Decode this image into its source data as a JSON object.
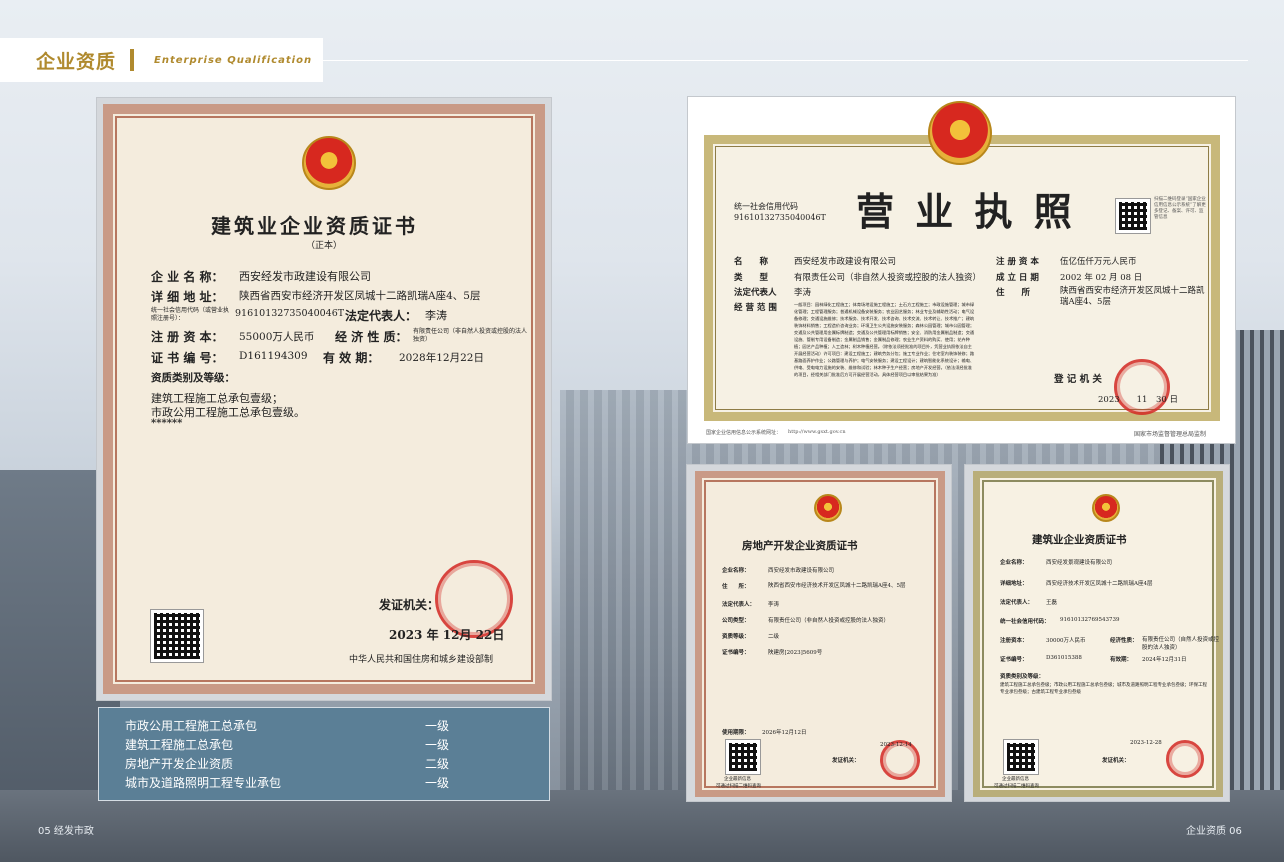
{
  "header": {
    "title": "企业资质",
    "subtitle": "Enterprise Qualification"
  },
  "main_cert": {
    "title": "建筑业企业资质证书",
    "copy_type": "（正本）",
    "company_label": "企 业 名 称：",
    "company": "西安经发市政建设有限公司",
    "address_label": "详 细 地 址：",
    "address": "陕西省西安市经济开发区凤城十二路凯瑞A座4、5层",
    "credit_label": "统一社会信用代码（或营业执照注册号）：",
    "credit_code": "91610132735040046T",
    "rep_label": "法定代表人：",
    "rep": "李涛",
    "capital_label": "注 册 资 本：",
    "capital": "55000万人民币",
    "nature_label": "经 济 性 质：",
    "nature": "有限责任公司（非自然人投资或控股的法人独资）",
    "number_label": "证 书 编 号：",
    "number": "D161194309",
    "valid_label": "有 效 期：",
    "valid": "2028年12月22日",
    "category_label": "资质类别及等级：",
    "category_1": "建筑工程施工总承包壹级；",
    "category_2": "市政公用工程施工总承包壹级。",
    "stars": "******",
    "issuer_label": "发证机关：",
    "issue_date": "2023 年 12月 22日",
    "ministry": "中华人民共和国住房和城乡建设部制"
  },
  "license": {
    "title": "营 业 执 照",
    "credit_label": "统一社会信用代码",
    "credit_code": "91610132735040046T",
    "name_label": "名　　称",
    "name": "西安经发市政建设有限公司",
    "type_label": "类　　型",
    "type": "有限责任公司（非自然人投资或控股的法人独资）",
    "rep_label": "法定代表人",
    "rep": "李涛",
    "scope_label": "经 营 范 围",
    "scope": "一般项目：园林绿化工程施工；体育场地设施工程施工；土石方工程施工；市政设施管理；城市绿化管理；工程管理服务；普通机械设备安装服务；农业园艺服务；林业专业及辅助性活动；电气设备修理；交通设施维修；技术服务、技术开发、技术咨询、技术交流、技术转让、技术推广；建筑装饰材料销售；工程造价咨询业务；环境卫生公共设施安装服务；森林公园管理；城市公园管理；交通及公共管理用金属标牌制造；交通及公共管理用标牌销售；安全、消防用金属制品制造；交通设施、管制专用设备制造；金属制品销售；金属制品修理；农业生产资料的购买、使用；花卉种植；园艺产品种植；人工造林；树木种植经营。（除依法须经批准的项目外，凭营业执照依法自主开展经营活动）许可项目：建设工程施工；建筑劳务分包；施工专业作业；住宅室内装饰装修；路基路面养护作业；公路管理与养护；电气安装服务；建设工程设计；建筑智能化系统设计；输电、供电、受电电力设施的安装、维修和试验；林木种子生产经营；房地产开发经营。（依法须经批准的项目，经相关部门批准后方可开展经营活动，具体经营项目以审批结果为准）",
    "capital_label": "注 册 资 本",
    "capital": "伍亿伍仟万元人民币",
    "date_label": "成 立 日 期",
    "date": "2002 年 02 月 08 日",
    "address_label": "住　　所",
    "address": "陕西省西安市经济开发区凤城十二路凯瑞A座4、5层",
    "qr_note": "扫描二维码登录“国家企业信用信息公示系统”了解更多登记、备案、许可、监管信息",
    "registrar_label": "登 记 机 关",
    "reg_date": "2023　　11　30 日",
    "footer_left": "国家企业信用信息公示系统网址：",
    "footer_url": "http://www.gsxt.gov.cn",
    "footer_right": "国家市场监督管理总局监制"
  },
  "realestate": {
    "title": "房地产开发企业资质证书",
    "company_label": "企业名称：",
    "company": "西安经发市政建设有限公司",
    "address_label": "住　　所：",
    "address": "陕西省西安市经济技术开发区凤城十二路凯瑞A座4、5层",
    "rep_label": "法定代表人：",
    "rep": "李涛",
    "nature_label": "公司类型：",
    "nature": "有限责任公司（非自然人投资或控股的法人独资）",
    "grade_label": "资质等级：",
    "grade": "二级",
    "number_label": "证书编号：",
    "number": "陕建房[2023]5609号",
    "valid_label": "使用期限：",
    "valid": "2026年12月12日",
    "issuer_label": "发证机关：",
    "issue_date": "2023-12-14",
    "qr_caption_1": "企业最新信息",
    "qr_caption_2": "可通过扫描二维码查询"
  },
  "construction2": {
    "title": "建筑业企业资质证书",
    "company_label": "企业名称：",
    "company": "西安经发景观建设有限公司",
    "address_label": "详细地址：",
    "address": "西安经济技术开发区凤城十二路凯瑞A座4层",
    "rep_label": "法定代表人：",
    "rep": "王磊",
    "credit_label": "统一社会信用代码：",
    "credit_code": "91610132769543739",
    "capital_label": "注册资本：",
    "capital": "30000万人民币",
    "nature_label": "经济性质：",
    "nature": "有限责任公司（自然人投资或控股的法人独资）",
    "number_label": "证书编号：",
    "number": "D361015388",
    "valid_label": "有效期：",
    "valid": "2024年12月31日",
    "category_label": "资质类别及等级：",
    "category": "建筑工程施工总承包叁级；市政公用工程施工总承包叁级；城市及道路照明工程专业承包叁级；环保工程专业承包叁级；古建筑工程专业承包叁级",
    "issuer_label": "发证机关：",
    "issue_date": "2023-12-28",
    "qr_caption_1": "企业最新信息",
    "qr_caption_2": "可通过扫描二维码查询"
  },
  "qualifications": [
    {
      "name": "市政公用工程施工总承包",
      "level": "一级"
    },
    {
      "name": "建筑工程施工总承包",
      "level": "一级"
    },
    {
      "name": "房地产开发企业资质",
      "level": "二级"
    },
    {
      "name": "城市及道路照明工程专业承包",
      "level": "一级"
    }
  ],
  "footer": {
    "left": "05  经发市政",
    "right": "企业资质  06"
  }
}
